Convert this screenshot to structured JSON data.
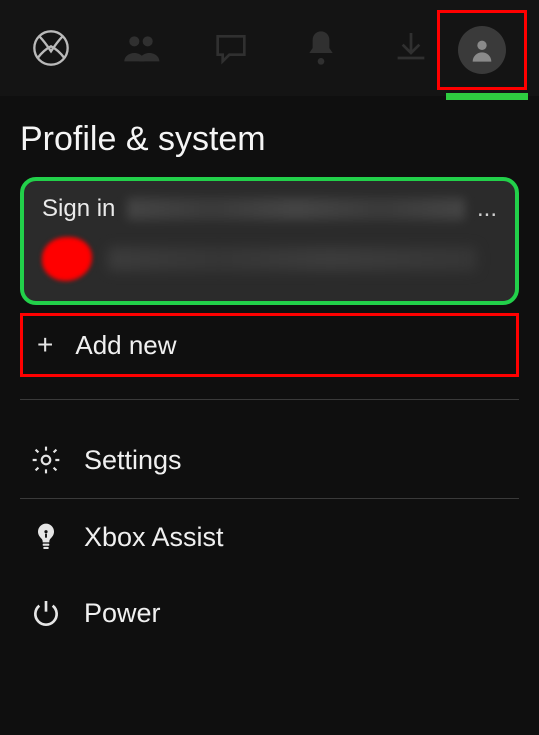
{
  "header": {
    "title": "Profile & system"
  },
  "signin": {
    "label": "Sign in",
    "account_blurred": "[redacted]@outlook.c",
    "email_blurred": "[redacted]@outlook.com"
  },
  "add_new": {
    "label": "Add new"
  },
  "menu": {
    "settings": "Settings",
    "xbox_assist": "Xbox Assist",
    "power": "Power"
  },
  "highlights": {
    "profile_tab_color": "#ff0000",
    "signin_card_color": "#22d04a",
    "add_new_color": "#ff0000"
  }
}
